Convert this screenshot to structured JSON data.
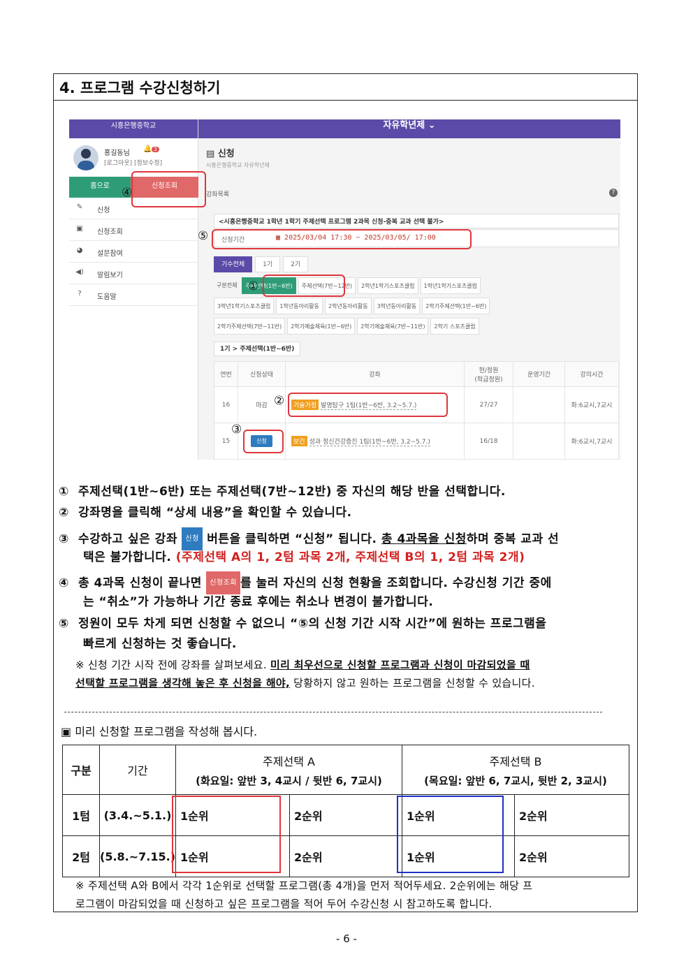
{
  "section_title": "4. 프로그램 수강신청하기",
  "screenshot": {
    "school_name": "시흥은행중학교",
    "top_title": "자유학년제 ⌄",
    "user_name": "홍길동님",
    "bell_count": "2",
    "user_links": "[로그아웃] [정보수정]",
    "home_btn": "홈으로",
    "lookup_btn": "신청조회",
    "menu": [
      {
        "icon": "✎",
        "label": "신청"
      },
      {
        "icon": "▣",
        "label": "신청조회"
      },
      {
        "icon": "◕",
        "label": "설문참여"
      },
      {
        "icon": "◀)",
        "label": "알림보기"
      },
      {
        "icon": "?",
        "label": "도움말"
      }
    ],
    "page_title": "신청",
    "page_sub": "시흥은행중학교 자유학년제",
    "list_label": "강좌목록",
    "notice": "<시흥은행중학교 1학년 1학기 주제선택 프로그램 2과목 신청-중복 교과 선택 불가>",
    "period_label": "신청기간",
    "period_value": "2025/03/04 17:30 ~ 2025/03/05/ 17:00",
    "tabs": [
      "기수전체",
      "1기",
      "2기"
    ],
    "chip_rows": [
      [
        "구분전체",
        "주제선택(1반~6반)",
        "주제선택(7반~12반)",
        "2학년1학기스포츠클럽",
        "1학년1학기스포츠클럽"
      ],
      [
        "3학년1학기스포츠클럽",
        "1학년동아리활동",
        "2학년동아리활동",
        "3학년동아리활동",
        "2학기주제선택(1반~6반)"
      ],
      [
        "2학기주제선택(7반~11반)",
        "2학기예술체육(1반~6반)",
        "2학기예술체육(7반~11반)",
        "2학기 스포츠클럽"
      ]
    ],
    "crumb": "1기 > 주제선택(1반~6반)",
    "table_headers": [
      "연번",
      "신청상태",
      "강좌",
      "현/정원\n(학급정원)",
      "운영기간",
      "강의시간"
    ],
    "rows": [
      {
        "no": "16",
        "status": "마감",
        "tag": "기술가정",
        "tag_color": "#f0a020",
        "course": "발명탐구 1팀(1반~6반, 3.2~5.7.)",
        "count": "27/27",
        "period": "",
        "time": "화:6교시,7교시"
      },
      {
        "no": "15",
        "status": "신청",
        "tag": "보건",
        "tag_color": "#f0a020",
        "course": "성과 정신건강증진 1팀(1반~6반, 3.2~5.7.)",
        "count": "16/18",
        "period": "",
        "time": "화:6교시,7교시"
      }
    ],
    "markers": [
      "①",
      "②",
      "③",
      "④",
      "⑤"
    ]
  },
  "instructions": {
    "i1_num": "①",
    "i1_text": "주제선택(1반~6반) 또는 주제선택(7반~12반) 중 자신의 해당 반을 선택합니다.",
    "i2_num": "②",
    "i2_text": "강좌명을 클릭해 “상세 내용”을 확인할 수 있습니다.",
    "i3_num": "③",
    "i3_a": "수강하고 싶은 강좌",
    "i3_btn": "신청",
    "i3_b": "버튼을 클릭하면 “신청” 됩니다.",
    "i3_c": "총 4과목을 신청",
    "i3_d": "하며 중복 교과 선",
    "i3_e": "택은 불가합니다.",
    "i3_red": "(주제선택 A의 1, 2텀 과목 2개, 주제선택 B의 1, 2텀 과목 2개)",
    "i4_num": "④",
    "i4_a": "총 4과목 신청이 끝나면",
    "i4_btn": "신청조회",
    "i4_b": "를 눌러 자신의 신청 현황을 조회합니다. 수강신청 기간 중에",
    "i4_c": "는 “취소”가 가능하나 기간 종료 후에는 취소나 변경이 불가합니다.",
    "i5_num": "⑤",
    "i5_a": "정원이 모두 차게 되면 신청할 수 없으니 “⑤의 신청 기간 시작 시간”에 원하는 프로그램을",
    "i5_b": "빠르게 신청하는 것 좋습니다.",
    "note_a": "※ 신청 기간 시작 전에 강좌를 살펴보세요.",
    "note_ul1": "미리 최우선으로 신청할 프로그램과 신청이 마감되었을 때",
    "note_ul2": "선택할 프로그램을 생각해 놓은 후 신청을 해야,",
    "note_b": "당황하지 않고 원하는 프로그램을 신청할 수 있습니다."
  },
  "plan": {
    "heading": "▣ 미리 신청할 프로그램을 작성해 봅시다.",
    "col_gubun": "구분",
    "col_period": "기간",
    "col_a_title": "주제선택 A",
    "col_a_sub": "(화요일: 앞반 3, 4교시 / 뒷반 6, 7교시)",
    "col_b_title": "주제선택 B",
    "col_b_sub": "(목요일: 앞반 6, 7교시, 뒷반 2, 3교시)",
    "rows": [
      {
        "term": "1텀",
        "period": "(3.4.~5.1.)",
        "a1": "1순위",
        "a2": "2순위",
        "b1": "1순위",
        "b2": "2순위"
      },
      {
        "term": "2텀",
        "period": "(5.8.~7.15.)",
        "a1": "1순위",
        "a2": "2순위",
        "b1": "1순위",
        "b2": "2순위"
      }
    ],
    "note_a": "※ 주제선택 A와 B에서 각각 1순위로 선택할 프로그램(총 4개)을 먼저 적어두세요. 2순위에는 해당 프",
    "note_b": "로그램이 마감되었을 때 신청하고 싶은 프로그램을 적어 두어 수강신청 시 참고하도록 합니다."
  },
  "page_number": "- 6 -"
}
